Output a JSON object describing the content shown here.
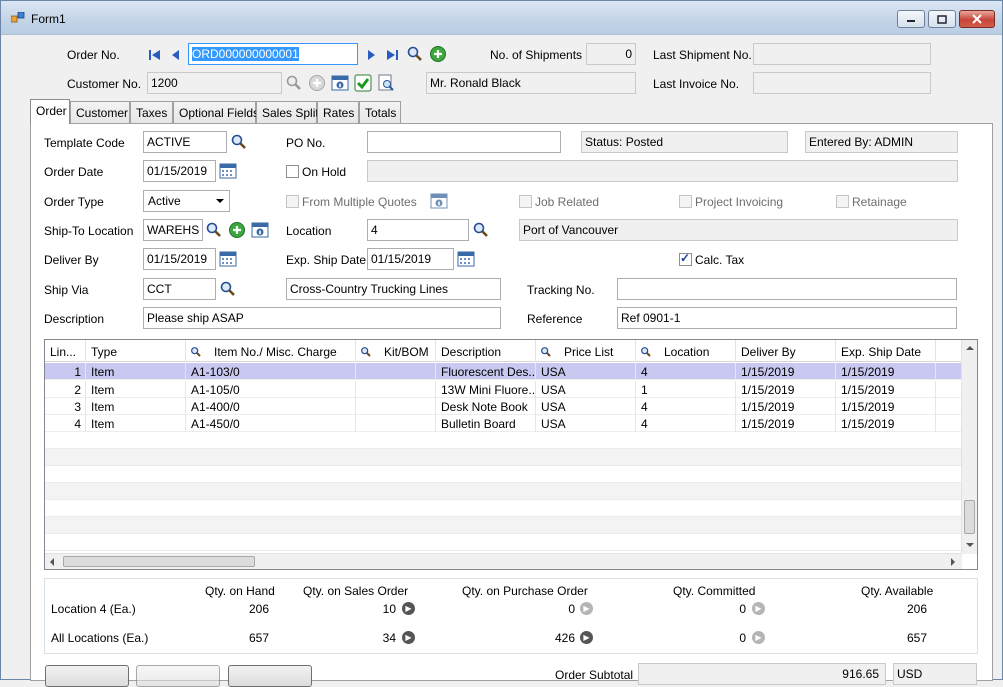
{
  "window": {
    "title": "Form1"
  },
  "header": {
    "order_no_label": "Order No.",
    "order_no_value": "ORD000000000001",
    "customer_no_label": "Customer No.",
    "customer_no_value": "1200",
    "customer_name": "Mr. Ronald Black",
    "shipments_label": "No. of Shipments",
    "shipments_value": "0",
    "last_shipment_label": "Last Shipment No.",
    "last_shipment_value": "",
    "last_invoice_label": "Last Invoice No.",
    "last_invoice_value": ""
  },
  "tabs": [
    {
      "label": "Order",
      "active": true
    },
    {
      "label": "Customer"
    },
    {
      "label": "Taxes"
    },
    {
      "label": "Optional Fields"
    },
    {
      "label": "Sales Split"
    },
    {
      "label": "Rates"
    },
    {
      "label": "Totals"
    }
  ],
  "order": {
    "template_code_label": "Template Code",
    "template_code_value": "ACTIVE",
    "po_no_label": "PO No.",
    "po_no_value": "",
    "status_text": "Status: Posted",
    "entered_by_text": "Entered By: ADMIN",
    "order_date_label": "Order Date",
    "order_date_value": "01/15/2019",
    "on_hold_label": "On Hold",
    "on_hold_reason": "",
    "order_type_label": "Order Type",
    "order_type_value": "Active",
    "from_multiple_quotes_label": "From Multiple Quotes",
    "job_related_label": "Job Related",
    "project_invoicing_label": "Project Invoicing",
    "retainage_label": "Retainage",
    "ship_to_label": "Ship-To Location",
    "ship_to_value": "WAREHS",
    "location_label": "Location",
    "location_value": "4",
    "location_desc": "Port of Vancouver",
    "deliver_by_label": "Deliver By",
    "deliver_by_value": "01/15/2019",
    "exp_ship_label": "Exp. Ship Date",
    "exp_ship_value": "01/15/2019",
    "calc_tax_label": "Calc. Tax",
    "ship_via_label": "Ship Via",
    "ship_via_value": "CCT",
    "ship_via_desc": "Cross-Country Trucking Lines",
    "tracking_label": "Tracking No.",
    "tracking_value": "",
    "description_label": "Description",
    "description_value": "Please ship ASAP",
    "reference_label": "Reference",
    "reference_value": "Ref 0901-1"
  },
  "grid": {
    "columns": [
      "Lin...",
      "Type",
      "Item No./ Misc. Charge",
      "Kit/BOM",
      "Description",
      "Price List",
      "Location",
      "Deliver By",
      "Exp. Ship Date"
    ],
    "rows": [
      [
        "1",
        "Item",
        "A1-103/0",
        "",
        "Fluorescent Des...",
        "USA",
        "4",
        "1/15/2019",
        "1/15/2019"
      ],
      [
        "2",
        "Item",
        "A1-105/0",
        "",
        "13W Mini Fluore...",
        "USA",
        "1",
        "1/15/2019",
        "1/15/2019"
      ],
      [
        "3",
        "Item",
        "A1-400/0",
        "",
        "Desk Note Book",
        "USA",
        "4",
        "1/15/2019",
        "1/15/2019"
      ],
      [
        "4",
        "Item",
        "A1-450/0",
        "",
        "Bulletin Board",
        "USA",
        "4",
        "1/15/2019",
        "1/15/2019"
      ]
    ]
  },
  "qty": {
    "headers": [
      "Qty. on Hand",
      "Qty. on Sales Order",
      "Qty. on Purchase Order",
      "Qty. Committed",
      "Qty. Available"
    ],
    "location_label": "Location  4 (Ea.)",
    "location_values": [
      "206",
      "10",
      "0",
      "0",
      "206"
    ],
    "all_label": "All Locations (Ea.)",
    "all_values": [
      "657",
      "34",
      "426",
      "0",
      "657"
    ]
  },
  "footer": {
    "total_label": "Order Subtotal",
    "total_value": "916.65",
    "currency": "USD"
  }
}
